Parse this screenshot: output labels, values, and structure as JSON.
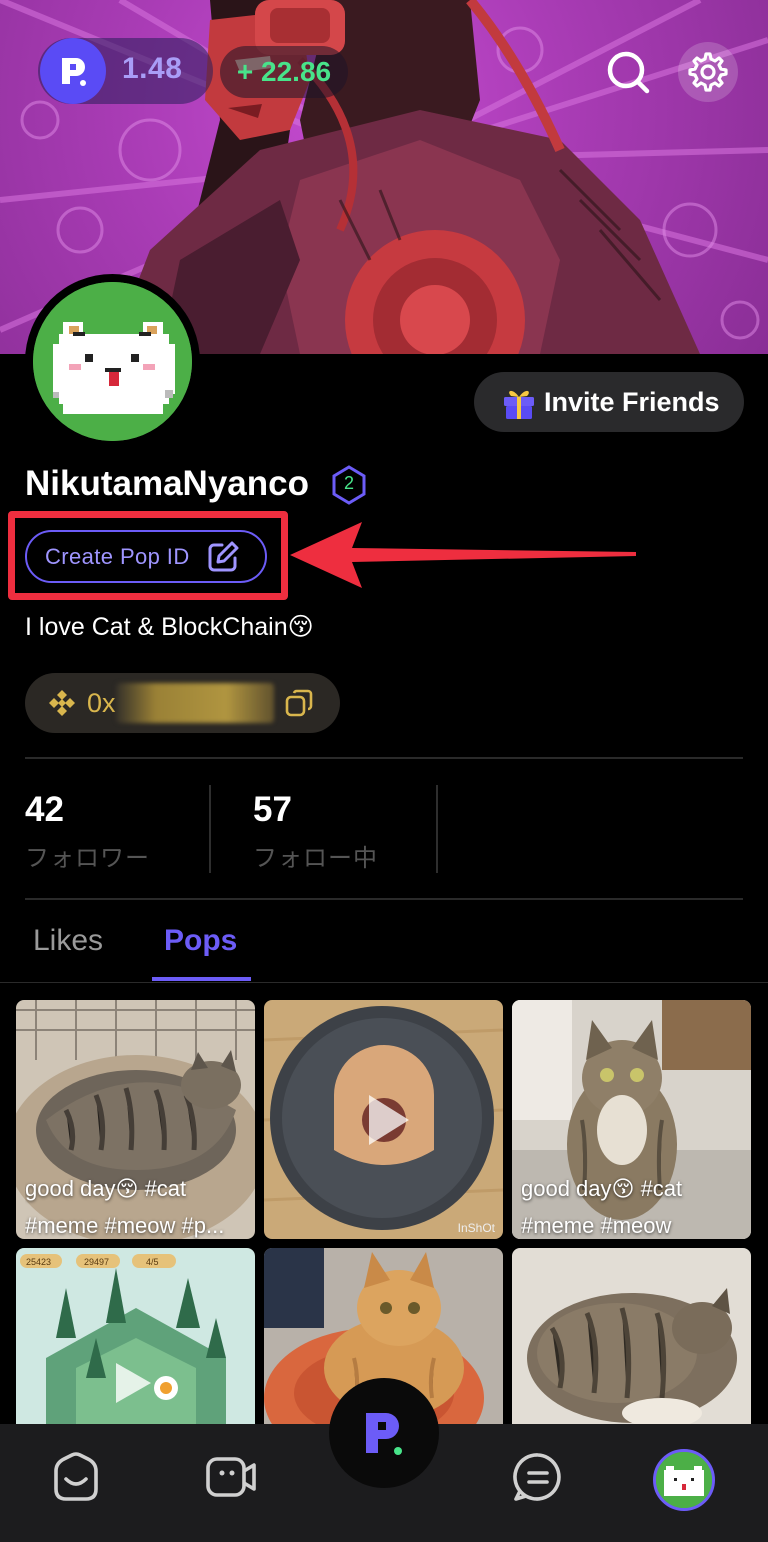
{
  "header": {
    "points_value": "1.48",
    "points_delta": "+ 22.86",
    "accent_color": "#5a4bf5",
    "delta_color": "#48e48a"
  },
  "profile": {
    "username": "NikutamaNyanco",
    "level": "2",
    "create_pop_id_label": "Create Pop ID",
    "bio": "I love Cat & BlockChain😚",
    "wallet_prefix": "0x",
    "invite_label": "Invite Friends"
  },
  "stats": {
    "followers_count": "42",
    "followers_label": "フォロワー",
    "following_count": "57",
    "following_label": "フォロー中"
  },
  "tabs": [
    {
      "label": "Likes",
      "active": false
    },
    {
      "label": "Pops",
      "active": true
    }
  ],
  "grid": {
    "tiles": [
      {
        "caption_line1": "good day😚 #cat",
        "caption_line2": "#meme #meow #p..."
      },
      {
        "caption_line1": "",
        "caption_line2": "",
        "watermark": "InShOt"
      },
      {
        "caption_line1": "good day😚 #cat",
        "caption_line2": "#meme #meow"
      },
      {
        "caption_line1": "",
        "caption_line2": "",
        "game_hud": [
          "25423",
          "29497",
          "4/5"
        ]
      },
      {
        "caption_line1": "",
        "caption_line2": ""
      },
      {
        "caption_line1": "",
        "caption_line2": ""
      }
    ]
  },
  "annotation": {
    "highlight_color": "#ee2e3f"
  },
  "nav": {
    "icons": [
      "home-icon",
      "video-icon",
      "pop-logo-icon",
      "chat-icon",
      "profile-avatar"
    ]
  }
}
